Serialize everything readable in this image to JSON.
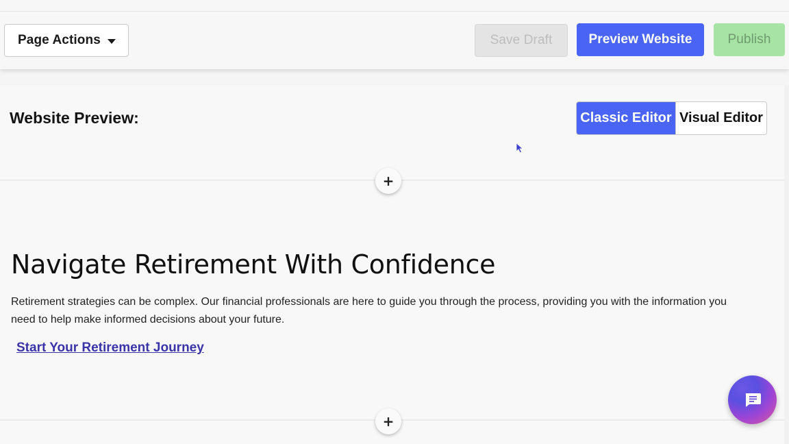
{
  "toolbar": {
    "page_actions_label": "Page Actions",
    "save_draft_label": "Save Draft",
    "preview_website_label": "Preview Website",
    "publish_label": "Publish"
  },
  "preview": {
    "label": "Website Preview:",
    "editor_modes": [
      "Classic Editor",
      "Visual Editor"
    ],
    "selected_mode": "Classic Editor"
  },
  "section": {
    "add_section_symbol": "+",
    "title": "Navigate Retirement With Confidence",
    "body": "Retirement strategies can be complex. Our financial professionals are here to guide you through the process, providing you with the information you need to help make informed decisions about your future.",
    "link_text": "Start Your Retirement Journey"
  },
  "icons": {
    "caret": "chevron-down-icon",
    "add": "plus-icon",
    "chat": "chat-icon",
    "cursor": "mouse-pointer-icon"
  },
  "colors": {
    "primary": "#4a64f5",
    "publish_disabled": "#a8e3a6",
    "link": "#3b34a8"
  }
}
